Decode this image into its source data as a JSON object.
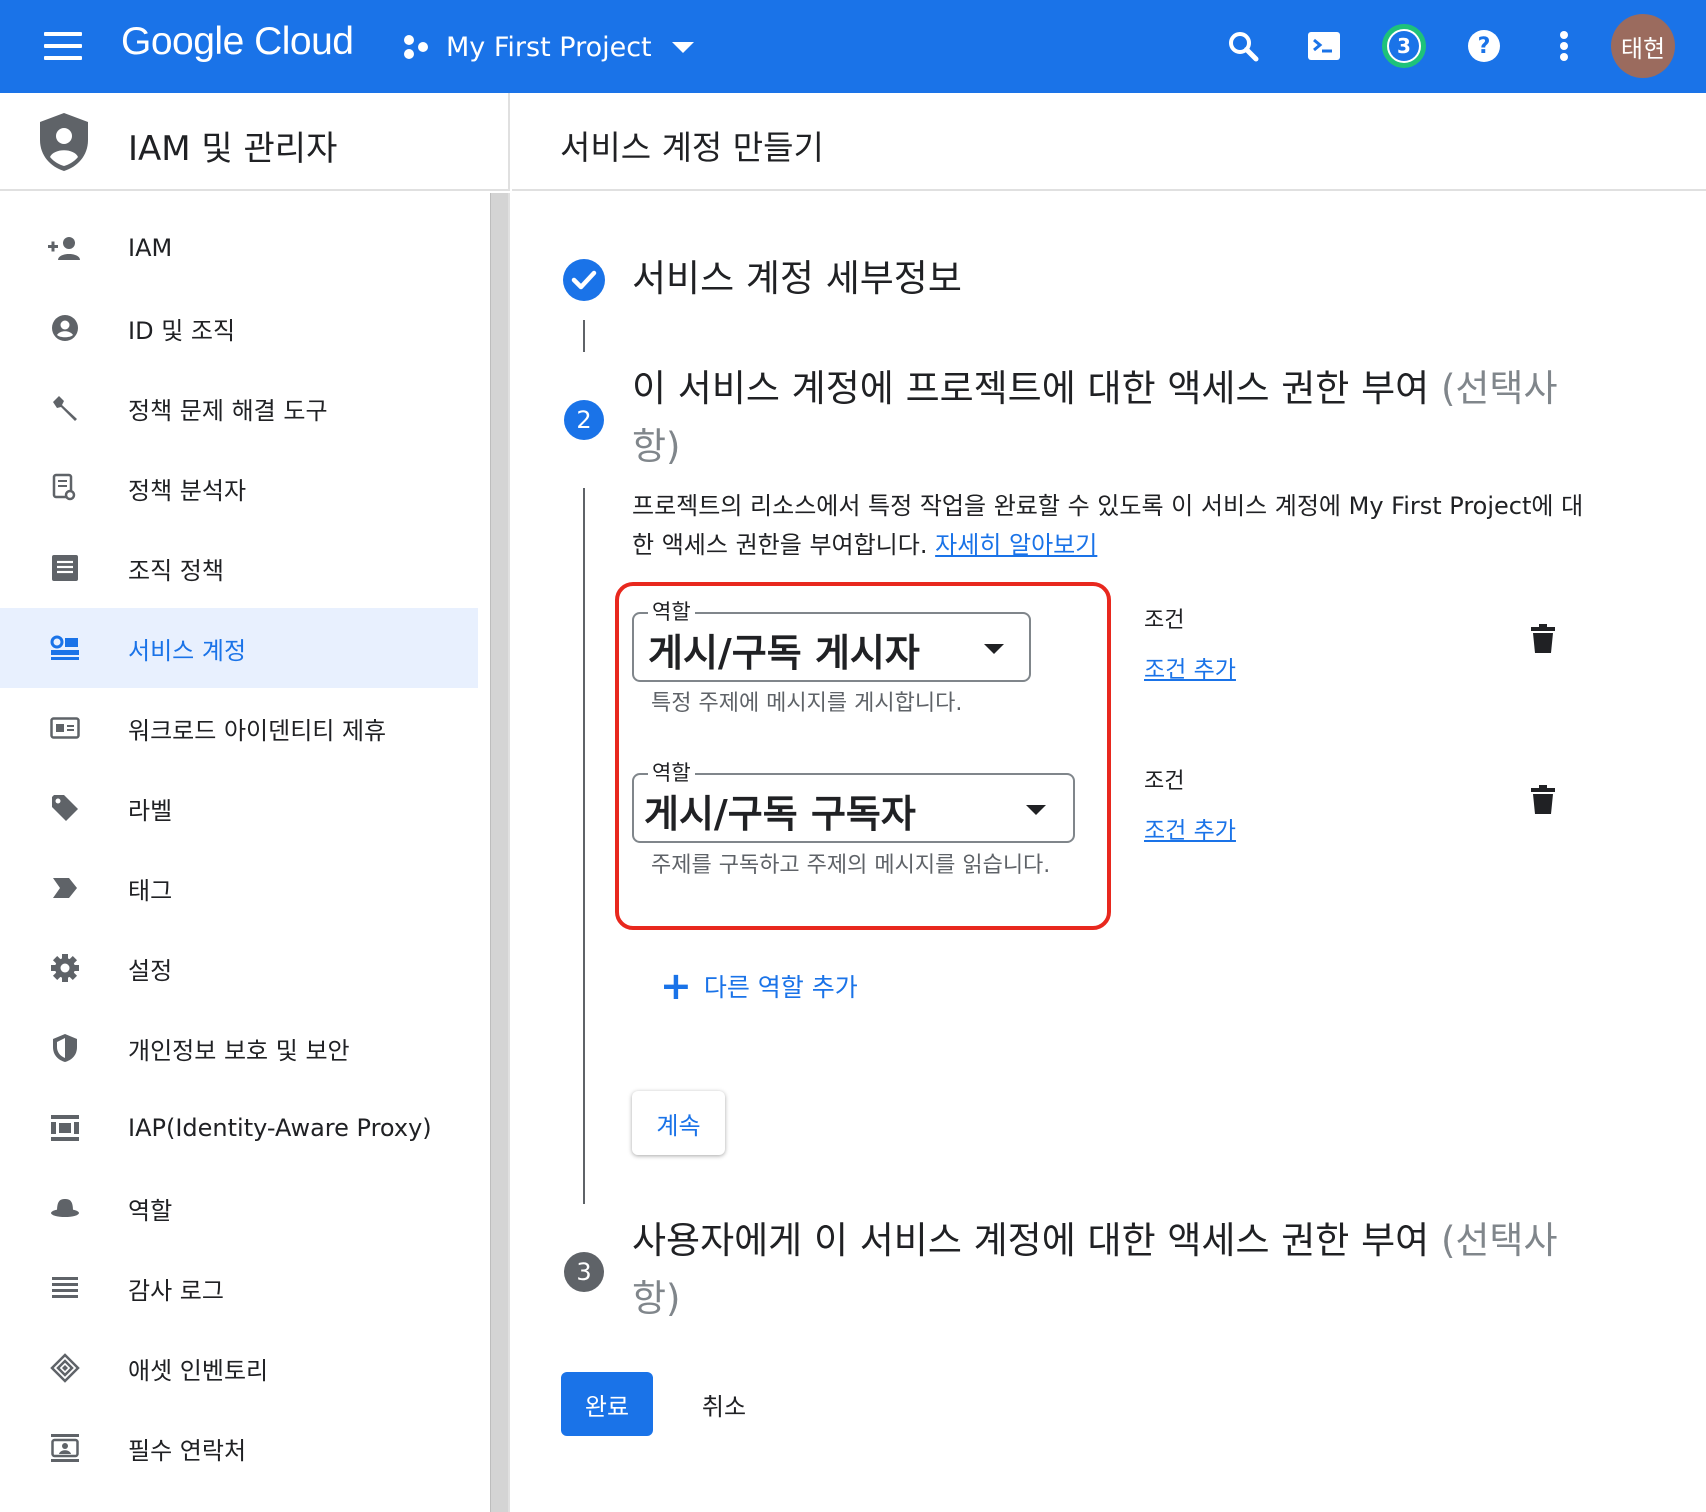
{
  "topbar": {
    "brand": "Google Cloud",
    "project_name": "My First Project",
    "notification_count": "3",
    "help_glyph": "?",
    "avatar_text": "태현",
    "icons": [
      "menu-icon",
      "project-dots-icon",
      "search-icon",
      "cloud-shell-icon",
      "notifications-icon",
      "help-icon",
      "more-vert-icon"
    ]
  },
  "sidebar": {
    "title": "IAM 및 관리자",
    "items": [
      {
        "label": "IAM",
        "icon": "person-add-icon"
      },
      {
        "label": "ID 및 조직",
        "icon": "account-circle-icon"
      },
      {
        "label": "정책 문제 해결 도구",
        "icon": "wrench-icon"
      },
      {
        "label": "정책 분석자",
        "icon": "policy-analyzer-icon"
      },
      {
        "label": "조직 정책",
        "icon": "document-icon"
      },
      {
        "label": "서비스 계정",
        "icon": "service-account-icon",
        "active": true
      },
      {
        "label": "워크로드 아이덴티티 제휴",
        "icon": "id-card-icon"
      },
      {
        "label": "라벨",
        "icon": "label-icon"
      },
      {
        "label": "태그",
        "icon": "tag-arrow-icon"
      },
      {
        "label": "설정",
        "icon": "gear-icon"
      },
      {
        "label": "개인정보 보호 및 보안",
        "icon": "shield-icon"
      },
      {
        "label": "IAP(Identity-Aware Proxy)",
        "icon": "iap-icon"
      },
      {
        "label": "역할",
        "icon": "hat-icon"
      },
      {
        "label": "감사 로그",
        "icon": "list-lines-icon"
      },
      {
        "label": "애셋 인벤토리",
        "icon": "diamond-layers-icon"
      },
      {
        "label": "필수 연락처",
        "icon": "contact-card-icon"
      }
    ]
  },
  "main": {
    "page_title": "서비스 계정 만들기",
    "step1": {
      "title": "서비스 계정 세부정보"
    },
    "step2": {
      "number": "2",
      "title": "이 서비스 계정에 프로젝트에 대한 액세스 권한 부여",
      "optional": "(선택사항)",
      "description": "프로젝트의 리소스에서 특정 작업을 완료할 수 있도록 이 서비스 계정에 My First Project에 대한 액세스 권한을 부여합니다.",
      "learn_more": "자세히 알아보기",
      "roles": [
        {
          "field_label": "역할",
          "value": "게시/구독 게시자",
          "help": "특정 주제에 메시지를 게시합니다.",
          "condition_label": "조건",
          "condition_link": "조건 추가"
        },
        {
          "field_label": "역할",
          "value": "게시/구독 구독자",
          "help": "주제를 구독하고 주제의 메시지를 읽습니다.",
          "condition_label": "조건",
          "condition_link": "조건 추가"
        }
      ],
      "add_role": "다른 역할 추가",
      "continue": "계속"
    },
    "step3": {
      "number": "3",
      "title": "사용자에게 이 서비스 계정에 대한 액세스 권한 부여",
      "optional": "(선택사항)"
    },
    "done": "완료",
    "cancel": "취소"
  },
  "colors": {
    "accent": "#1a73e8",
    "highlight": "#e8281e",
    "badge_ring": "#1ec27a",
    "avatar": "#9b6b5e"
  }
}
